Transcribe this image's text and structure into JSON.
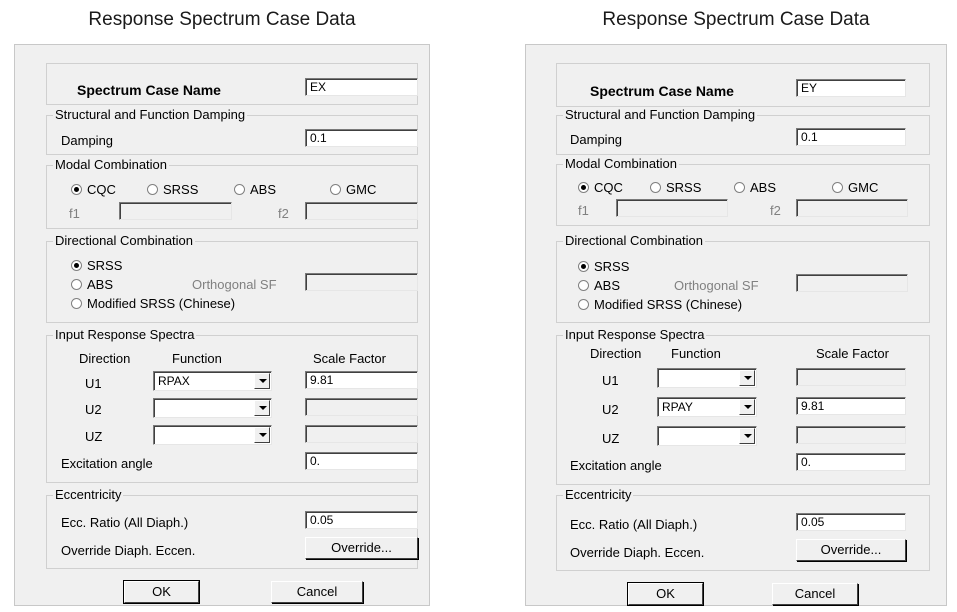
{
  "left": {
    "title": "Response Spectrum Case Data",
    "case_name_label": "Spectrum Case Name",
    "case_name_value": "EX",
    "damping_group": "Structural and Function Damping",
    "damping_label": "Damping",
    "damping_value": "0.1",
    "modal_group": "Modal Combination",
    "modal_options": [
      "CQC",
      "SRSS",
      "ABS",
      "GMC"
    ],
    "modal_selected": "CQC",
    "f1_label": "f1",
    "f2_label": "f2",
    "directional_group": "Directional Combination",
    "dir_srss": "SRSS",
    "dir_abs": "ABS",
    "orthogonal_sf_label": "Orthogonal SF",
    "dir_modified": "Modified SRSS (Chinese)",
    "dir_selected": "SRSS",
    "input_group": "Input Response Spectra",
    "col_direction": "Direction",
    "col_function": "Function",
    "col_scale": "Scale Factor",
    "rows": [
      {
        "dir": "U1",
        "function": "RPAX",
        "scale": "9.81"
      },
      {
        "dir": "U2",
        "function": "",
        "scale": ""
      },
      {
        "dir": "UZ",
        "function": "",
        "scale": ""
      }
    ],
    "excitation_label": "Excitation angle",
    "excitation_value": "0.",
    "ecc_group": "Eccentricity",
    "ecc_ratio_label": "Ecc. Ratio (All Diaph.)",
    "ecc_ratio_value": "0.05",
    "override_label": "Override Diaph. Eccen.",
    "override_button": "Override...",
    "ok_button": "OK",
    "cancel_button": "Cancel"
  },
  "right": {
    "title": "Response Spectrum Case Data",
    "case_name_label": "Spectrum Case Name",
    "case_name_value": "EY",
    "damping_group": "Structural and Function Damping",
    "damping_label": "Damping",
    "damping_value": "0.1",
    "modal_group": "Modal Combination",
    "modal_options": [
      "CQC",
      "SRSS",
      "ABS",
      "GMC"
    ],
    "modal_selected": "CQC",
    "f1_label": "f1",
    "f2_label": "f2",
    "directional_group": "Directional Combination",
    "dir_srss": "SRSS",
    "dir_abs": "ABS",
    "orthogonal_sf_label": "Orthogonal SF",
    "dir_modified": "Modified SRSS (Chinese)",
    "dir_selected": "SRSS",
    "input_group": "Input Response Spectra",
    "col_direction": "Direction",
    "col_function": "Function",
    "col_scale": "Scale Factor",
    "rows": [
      {
        "dir": "U1",
        "function": "",
        "scale": ""
      },
      {
        "dir": "U2",
        "function": "RPAY",
        "scale": "9.81"
      },
      {
        "dir": "UZ",
        "function": "",
        "scale": ""
      }
    ],
    "excitation_label": "Excitation angle",
    "excitation_value": "0.",
    "ecc_group": "Eccentricity",
    "ecc_ratio_label": "Ecc. Ratio (All Diaph.)",
    "ecc_ratio_value": "0.05",
    "override_label": "Override Diaph. Eccen.",
    "override_button": "Override...",
    "ok_button": "OK",
    "cancel_button": "Cancel"
  }
}
